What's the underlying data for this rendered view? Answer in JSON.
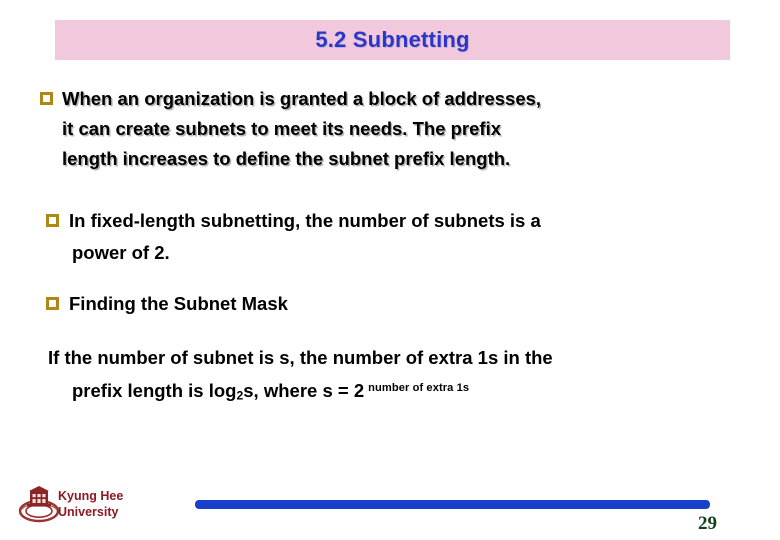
{
  "slide": {
    "title": "5.2 Subnetting",
    "title_bar_color": "#F2C9DC",
    "title_text_color": "#2A36C8"
  },
  "bullets": [
    {
      "marker": "hollow-square-bullet",
      "marker_color": "#B08618",
      "line_1": "When an organization is granted a block of addresses,",
      "line_2": "it can create subnets to meet its needs.  The prefix",
      "line_3": "length increases to define the subnet prefix length."
    },
    {
      "marker": "hollow-square-bullet",
      "marker_color": "#B08618",
      "line_1": "In fixed-length subnetting, the number of subnets is a",
      "line_2": "power of 2."
    },
    {
      "marker": "hollow-square-bullet",
      "marker_color": "#B08618",
      "line_1": "Finding the Subnet Mask"
    }
  ],
  "formula": {
    "line_1": "If the number of subnet is s, the number of extra 1s in the",
    "line_2_a": "prefix length is log",
    "line_2_sub": "2",
    "line_2_b": "s, where s = 2",
    "line_2_exponent": "number of extra 1s"
  },
  "footer": {
    "logo_name": "kyung-hee-university-logo",
    "university": "Kyung Hee\nUniversity",
    "university_color": "#8B1A24",
    "bar_color": "#1740CC",
    "page_number": "29",
    "page_number_color": "#10401C"
  }
}
